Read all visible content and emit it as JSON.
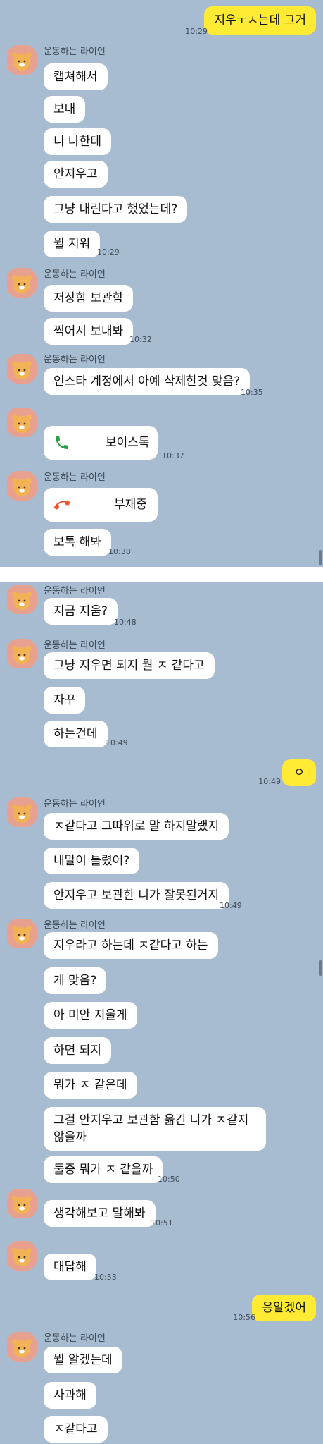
{
  "sender_name": "운동하는 라이언",
  "msgs": {
    "m0": "지우ㅜㅅ는데 그거",
    "t0": "10:29",
    "m1": "캡쳐해서",
    "m2": "보내",
    "m3": "니 나한테",
    "m4": "안지우고",
    "m5": "그냥 내린다고 했었는데?",
    "m6": "뭘 지워",
    "t6": "10:29",
    "m7": "저장함 보관함",
    "m8": "찍어서 보내봐",
    "t8": "10:32",
    "m9": "인스타 계정에서 아예 삭제한것 맞음?",
    "t9": "10:35",
    "call1": "보이스톡",
    "tc1": "10:37",
    "call2": "부재중",
    "m10": "보톡 해봐",
    "t10": "10:38",
    "m11": "지금 지움?",
    "t11": "10:48",
    "m12": "그냥 지우면 되지 뭘 ㅈ 같다고",
    "m13": "자꾸",
    "m14": "하는건데",
    "t14": "10:49",
    "m15": "ㅇ",
    "t15": "10:49",
    "m16": "ㅈ같다고 그따위로 말 하지말랬지",
    "m17": "내말이 틀렸어?",
    "m18": "안지우고 보관한 니가 잘못된거지",
    "t18": "10:49",
    "m19": "지우라고 하는데 ㅈ같다고 하는",
    "m20": "게 맞음?",
    "m21": "아 미안 지울게",
    "m22": "하면 되지",
    "m23": "뭐가 ㅈ 같은데",
    "m24": "그걸 안지우고 보관함  옮긴 니가 ㅈ같지 않을까",
    "m25": "둘중 뭐가 ㅈ 같을까",
    "t25": "10:50",
    "m26": "생각해보고 말해봐",
    "t26": "10:51",
    "m27": "대답해",
    "t27": "10:53",
    "m28": "응알겠어",
    "t28": "10:56",
    "m29": "뭘 알겠는데",
    "m30": "사과해",
    "m31": "ㅈ같다고"
  }
}
